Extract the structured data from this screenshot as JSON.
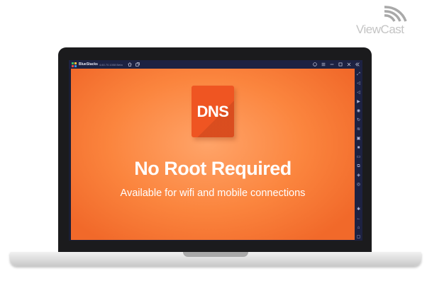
{
  "watermark": {
    "text": "ViewCast"
  },
  "window": {
    "app_title": "BlueStacks",
    "version": "4.60.70.1008 Beta",
    "title_icons": [
      "home-icon",
      "multi-instance-icon"
    ],
    "control_icons": [
      "help-icon",
      "menu-icon",
      "minimize-icon",
      "maximize-icon",
      "close-icon",
      "collapse-sidebar-icon"
    ]
  },
  "app_content": {
    "tile_text": "DNS",
    "headline": "No Root Required",
    "subline": "Available for wifi and mobile connections"
  },
  "side_toolbar": {
    "icons": [
      "fullscreen-icon",
      "volume-up-icon",
      "volume-down-icon",
      "play-icon",
      "camera-icon",
      "rotate-icon",
      "shake-icon",
      "screenshot-icon",
      "video-record-icon",
      "folder-icon",
      "copy-icon",
      "layers-icon",
      "eco-mode-icon",
      "settings-icon",
      "back-icon",
      "home-nav-icon",
      "recent-apps-icon"
    ]
  },
  "colors": {
    "orange_light": "#ffa469",
    "orange_mid": "#fb853e",
    "orange_dark": "#f1692a",
    "tile": "#ef5522",
    "frame": "#1b1b1d",
    "emulator_chrome": "#1d2242"
  }
}
